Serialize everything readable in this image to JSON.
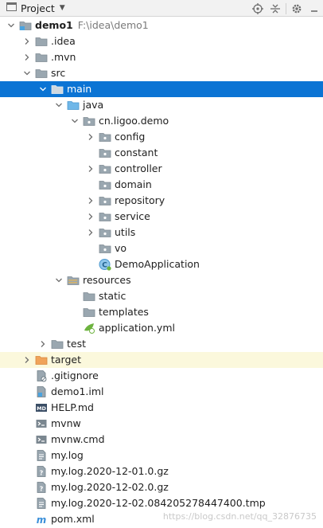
{
  "toolbar": {
    "title": "Project",
    "icons": [
      "project-view-icon",
      "chevron-down-icon",
      "locate-icon",
      "collapse-all-icon",
      "gear-icon",
      "minimize-icon"
    ]
  },
  "tree": [
    {
      "name": "demo1",
      "path": "F:\\idea\\demo1",
      "icon": "module-folder-icon",
      "expanded": true,
      "bold": true
    },
    {
      "name": ".idea",
      "icon": "folder-icon",
      "expanded": false
    },
    {
      "name": ".mvn",
      "icon": "folder-icon",
      "expanded": false
    },
    {
      "name": "src",
      "icon": "folder-icon",
      "expanded": true
    },
    {
      "name": "main",
      "icon": "folder-icon",
      "expanded": true,
      "selected": true
    },
    {
      "name": "java",
      "icon": "source-folder-icon",
      "expanded": true
    },
    {
      "name": "cn.ligoo.demo",
      "icon": "package-icon",
      "expanded": true
    },
    {
      "name": "config",
      "icon": "package-icon",
      "expanded": false
    },
    {
      "name": "constant",
      "icon": "package-icon"
    },
    {
      "name": "controller",
      "icon": "package-icon",
      "expanded": false
    },
    {
      "name": "domain",
      "icon": "package-icon"
    },
    {
      "name": "repository",
      "icon": "package-icon",
      "expanded": false
    },
    {
      "name": "service",
      "icon": "package-icon",
      "expanded": false
    },
    {
      "name": "utils",
      "icon": "package-icon",
      "expanded": false
    },
    {
      "name": "vo",
      "icon": "package-icon"
    },
    {
      "name": "DemoApplication",
      "icon": "spring-class-icon"
    },
    {
      "name": "resources",
      "icon": "resources-folder-icon",
      "expanded": true
    },
    {
      "name": "static",
      "icon": "folder-icon"
    },
    {
      "name": "templates",
      "icon": "folder-icon"
    },
    {
      "name": "application.yml",
      "icon": "spring-config-icon"
    },
    {
      "name": "test",
      "icon": "folder-icon",
      "expanded": false
    },
    {
      "name": "target",
      "icon": "excluded-folder-icon",
      "expanded": false,
      "highlighted": true
    },
    {
      "name": ".gitignore",
      "icon": "ignore-file-icon"
    },
    {
      "name": "demo1.iml",
      "icon": "iml-file-icon"
    },
    {
      "name": "HELP.md",
      "icon": "markdown-file-icon"
    },
    {
      "name": "mvnw",
      "icon": "script-file-icon"
    },
    {
      "name": "mvnw.cmd",
      "icon": "script-file-icon"
    },
    {
      "name": "my.log",
      "icon": "text-file-icon"
    },
    {
      "name": "my.log.2020-12-01.0.gz",
      "icon": "unknown-file-icon"
    },
    {
      "name": "my.log.2020-12-02.0.gz",
      "icon": "unknown-file-icon"
    },
    {
      "name": "my.log.2020-12-02.084205278447400.tmp",
      "icon": "text-file-icon"
    },
    {
      "name": "pom.xml",
      "icon": "maven-file-icon"
    }
  ],
  "watermark": "https://blog.csdn.net/qq_32876735"
}
